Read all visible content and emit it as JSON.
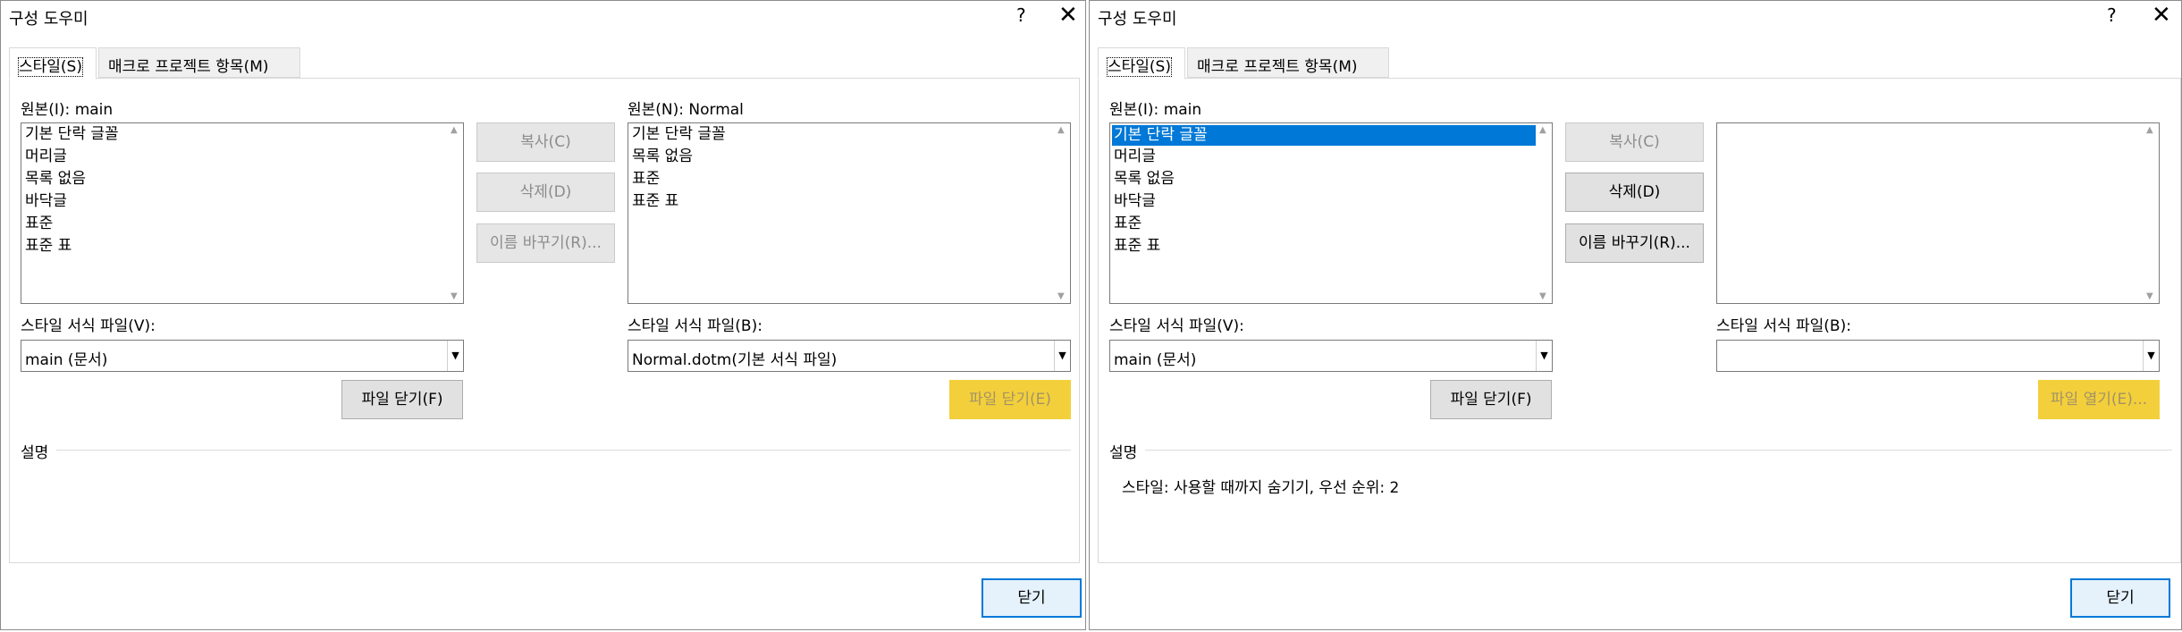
{
  "dialogs": [
    {
      "title": "구성 도우미",
      "help": "?",
      "close": "✕",
      "tabs": [
        "스타일(S)",
        "매크로 프로젝트 항목(M)"
      ],
      "left_label": "원본(I): main",
      "left_items": [
        "기본 단락 글꼴",
        "머리글",
        "목록 없음",
        "바닥글",
        "표준",
        "표준 표"
      ],
      "right_label": "원본(N): Normal",
      "right_items": [
        "기본 단락 글꼴",
        "목록 없음",
        "표준",
        "표준 표"
      ],
      "btn_copy": "복사(C)",
      "btn_delete": "삭제(D)",
      "btn_rename": "이름 바꾸기(R)...",
      "left_file_label": "스타일 서식 파일(V):",
      "left_file_value": "main (문서)",
      "left_file_button": "파일 닫기(F)",
      "right_file_label": "스타일 서식 파일(B):",
      "right_file_value": "Normal.dotm(기본 서식 파일)",
      "right_file_button": "파일 닫기(E)",
      "description_title": "설명",
      "description_text": "",
      "close_button": "닫기"
    },
    {
      "title": "구성 도우미",
      "help": "?",
      "close": "✕",
      "tabs": [
        "스타일(S)",
        "매크로 프로젝트 항목(M)"
      ],
      "left_label": "원본(I): main",
      "left_items": [
        "기본 단락 글꼴",
        "머리글",
        "목록 없음",
        "바닥글",
        "표준",
        "표준 표"
      ],
      "right_label": "",
      "right_items": [],
      "btn_copy": "복사(C)",
      "btn_delete": "삭제(D)",
      "btn_rename": "이름 바꾸기(R)...",
      "left_file_label": "스타일 서식 파일(V):",
      "left_file_value": "main (문서)",
      "left_file_button": "파일 닫기(F)",
      "right_file_label": "스타일 서식 파일(B):",
      "right_file_value": "",
      "right_file_button": "파일 열기(E)...",
      "description_title": "설명",
      "description_text": "스타일: 사용할 때까지 숨기기, 우선 순위: 2",
      "close_button": "닫기"
    }
  ],
  "colors": {
    "selection": "#0078d7",
    "highlight": "#f3d03b",
    "button": "#e1e1e1",
    "primary_border": "#0078d7"
  }
}
